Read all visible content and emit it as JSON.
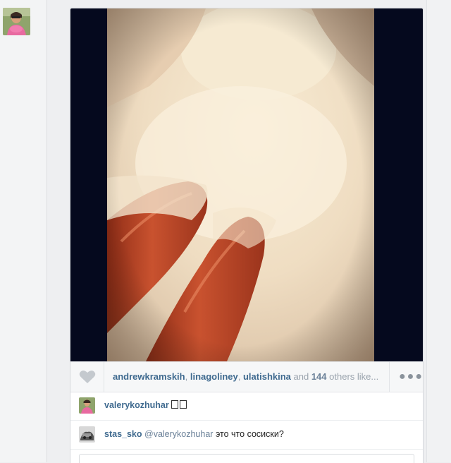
{
  "post": {
    "likes": {
      "likers": [
        "andrewkramskih",
        "linagoliney",
        "ulatishkina"
      ],
      "separator": ", ",
      "and_text": " and ",
      "others_count": "144",
      "others_text": " others like..."
    },
    "comments": [
      {
        "username": "valerykozhuhar",
        "text_boxes": 2
      },
      {
        "username": "stas_sko",
        "mention": "@valerykozhuhar",
        "text": " это что сосиски?"
      }
    ]
  },
  "icons": {
    "like": "heart-icon",
    "more": "more-dots-icon"
  },
  "colors": {
    "username": "#3f6a8f",
    "muted": "#9aa3ad",
    "photo_bg": "#05091e",
    "page_bg": "#eeeff1"
  }
}
